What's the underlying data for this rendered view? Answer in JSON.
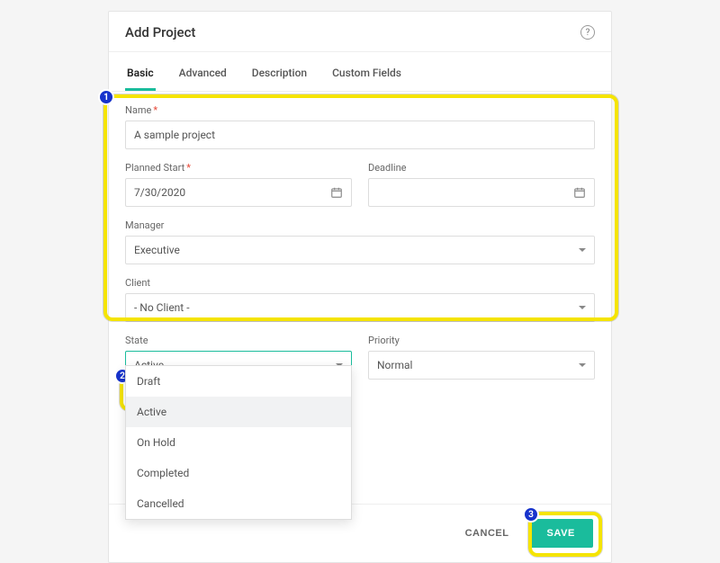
{
  "modal": {
    "title": "Add Project"
  },
  "tabs": [
    {
      "label": "Basic",
      "active": true
    },
    {
      "label": "Advanced",
      "active": false
    },
    {
      "label": "Description",
      "active": false
    },
    {
      "label": "Custom Fields",
      "active": false
    }
  ],
  "fields": {
    "name": {
      "label": "Name",
      "value": "A sample project",
      "required": true
    },
    "planned_start": {
      "label": "Planned Start",
      "value": "7/30/2020",
      "required": true
    },
    "deadline": {
      "label": "Deadline",
      "value": ""
    },
    "manager": {
      "label": "Manager",
      "value": "Executive"
    },
    "client": {
      "label": "Client",
      "value": "- No Client -"
    },
    "state": {
      "label": "State",
      "value": "Active",
      "options": [
        "Draft",
        "Active",
        "On Hold",
        "Completed",
        "Cancelled"
      ],
      "selected_index": 1
    },
    "priority": {
      "label": "Priority",
      "value": "Normal"
    }
  },
  "footer": {
    "cancel": "CANCEL",
    "save": "SAVE"
  },
  "annotations": {
    "n1": "1",
    "n2": "2",
    "n3": "3"
  }
}
